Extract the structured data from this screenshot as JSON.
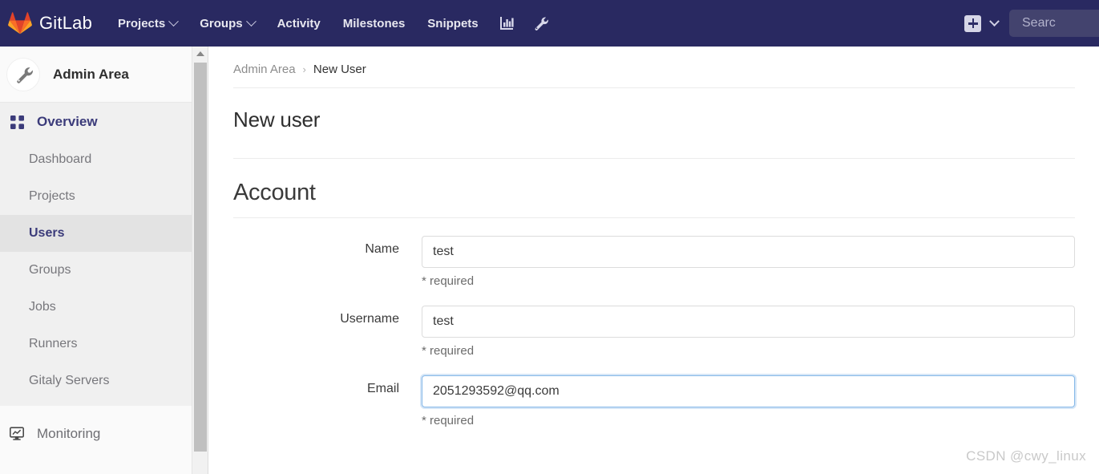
{
  "navbar": {
    "brand": "GitLab",
    "brand_logo_icon": "gitlab-fox-logo",
    "items": [
      {
        "label": "Projects",
        "has_caret": true
      },
      {
        "label": "Groups",
        "has_caret": true
      },
      {
        "label": "Activity",
        "has_caret": false
      },
      {
        "label": "Milestones",
        "has_caret": false
      },
      {
        "label": "Snippets",
        "has_caret": false
      }
    ],
    "icons": [
      {
        "name": "analytics-chart-icon"
      },
      {
        "name": "wrench-admin-icon"
      }
    ],
    "create_new_icon": "plus-square-icon",
    "create_new_caret_icon": "chevron-down-icon",
    "search_placeholder": "Searc",
    "background_color": "#292961"
  },
  "sidebar": {
    "avatar_icon": "wrench-icon",
    "title": "Admin Area",
    "section": {
      "icon": "grid-overview-icon",
      "label": "Overview",
      "items": [
        {
          "label": "Dashboard",
          "active": false
        },
        {
          "label": "Projects",
          "active": false
        },
        {
          "label": "Users",
          "active": true
        },
        {
          "label": "Groups",
          "active": false
        },
        {
          "label": "Jobs",
          "active": false
        },
        {
          "label": "Runners",
          "active": false
        },
        {
          "label": "Gitaly Servers",
          "active": false
        }
      ]
    },
    "bottom": {
      "icon": "monitor-screen-icon",
      "label": "Monitoring"
    },
    "scrollbar": {
      "up_arrow_icon": "caret-up-icon"
    }
  },
  "breadcrumb": {
    "parent": "Admin Area",
    "separator": "›",
    "current": "New User"
  },
  "page": {
    "title": "New user",
    "section_title": "Account"
  },
  "form": {
    "fields": [
      {
        "label": "Name",
        "value": "test",
        "placeholder": "",
        "help": "* required",
        "focused": false
      },
      {
        "label": "Username",
        "value": "test",
        "placeholder": "",
        "help": "* required",
        "focused": false
      },
      {
        "label": "Email",
        "value": "2051293592@qq.com",
        "placeholder": "",
        "help": "* required",
        "focused": true
      }
    ]
  },
  "watermark": "CSDN @cwy_linux"
}
